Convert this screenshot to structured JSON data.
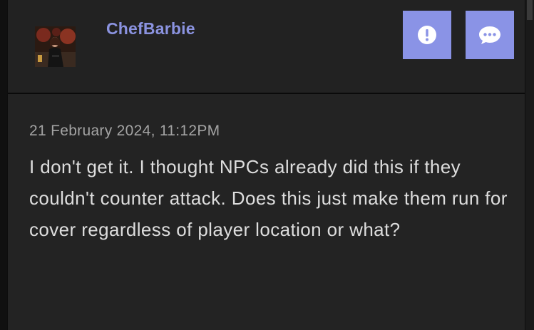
{
  "comment": {
    "username": "ChefBarbie",
    "timestamp": "21 February 2024, 11:12PM",
    "text": "I don't get it. I thought NPCs already did this if they couldn't counter attack. Does this just make them run for cover regardless of player location or what?"
  },
  "actions": {
    "report_icon": "exclamation-circle-icon",
    "reply_icon": "speech-bubble-icon"
  },
  "colors": {
    "accent": "#8a93e6",
    "username": "#8b93e0",
    "card_bg": "#232323",
    "page_bg": "#101010",
    "text": "#dddddd",
    "muted": "#a3a3a3"
  }
}
